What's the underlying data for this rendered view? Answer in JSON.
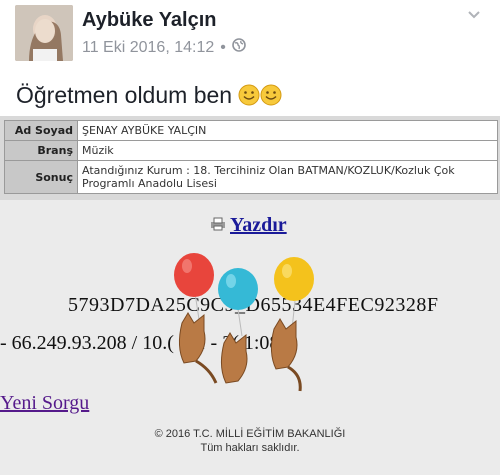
{
  "post": {
    "author": "Aybüke Yalçın",
    "timestamp": "11 Eki 2016, 14:12",
    "separator": "•",
    "privacy_icon": "public-globe-icon",
    "text": "Öğretmen oldum ben",
    "emojis": [
      "smiling-face-icon",
      "smiling-face-icon"
    ]
  },
  "screenshot": {
    "table": [
      {
        "label": "Ad Soyad",
        "value": "ŞENAY AYBÜKE YALÇIN"
      },
      {
        "label": "Branş",
        "value": "Müzik"
      },
      {
        "label": "Sonuç",
        "value": "Atandığınız Kurum : 18. Tercihiniz Olan BATMAN/KOZLUK/Kozluk Çok Programlı Anadolu Lisesi"
      }
    ],
    "print_label": "Yazdır",
    "code": "5793D7DA25C9C9_D65534E4FEC92328F",
    "ip_line": "- 66.249.93.208 / 10.( (01 - 2( 1:08",
    "new_query": "Yeni Sorgu",
    "footer_line1": "© 2016 T.C. MİLLİ EĞİTİM BAKANLIĞI",
    "footer_line2": "Tüm hakları saklıdır."
  },
  "colors": {
    "balloon_red": "#e8453c",
    "balloon_cyan": "#35b9d6",
    "balloon_yellow": "#f4c21c",
    "cat": "#b97a45"
  }
}
